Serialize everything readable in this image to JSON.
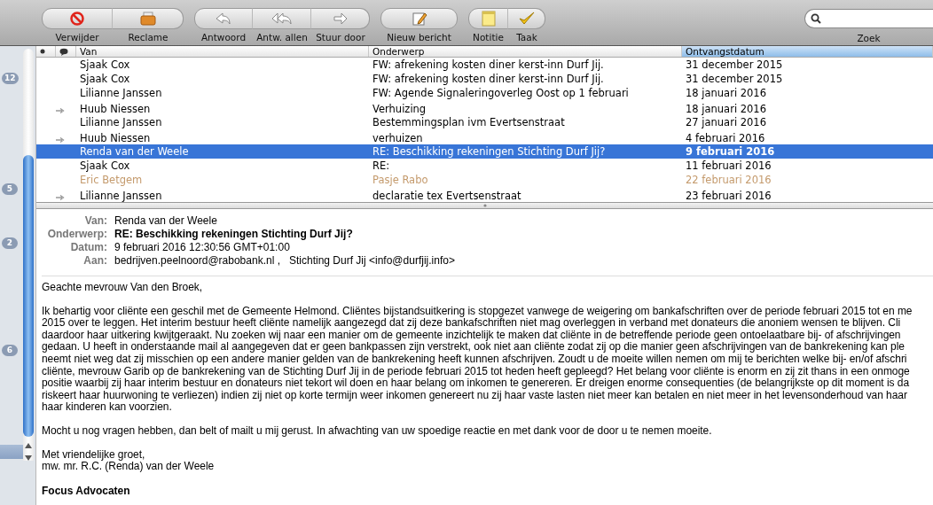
{
  "toolbar": {
    "groups": [
      {
        "buttons": [
          {
            "label": "Verwijder"
          },
          {
            "label": "Reclame"
          }
        ]
      },
      {
        "buttons": [
          {
            "label": "Antwoord"
          },
          {
            "label": "Antw. allen"
          },
          {
            "label": "Stuur door"
          }
        ]
      },
      {
        "buttons": [
          {
            "label": "Nieuw bericht"
          }
        ]
      },
      {
        "buttons": [
          {
            "label": "Notitie"
          },
          {
            "label": "Taak"
          }
        ]
      }
    ],
    "search": {
      "label": "Zoek"
    }
  },
  "sidebar": {
    "badges": [
      "12",
      "5",
      "2",
      "6"
    ]
  },
  "message_list": {
    "columns": [
      {
        "kind": "unread"
      },
      {
        "kind": "flag"
      },
      {
        "kind": "from",
        "label": "Van",
        "selected": false
      },
      {
        "kind": "subject",
        "label": "Onderwerp",
        "selected": false
      },
      {
        "kind": "date",
        "label": "Ontvangstdatum",
        "selected": true
      }
    ],
    "rows": [
      {
        "from": "Sjaak Cox",
        "subject": "FW: afrekening kosten diner kerst-inn Durf Jij.",
        "date": "31 december 2015",
        "forwarded": false,
        "selected": false
      },
      {
        "from": "Sjaak Cox",
        "subject": "FW: afrekening kosten diner kerst-inn Durf Jij.",
        "date": "31 december 2015",
        "forwarded": false,
        "selected": false
      },
      {
        "from": "Lilianne Janssen",
        "subject": "FW: Agende Signaleringoverleg Oost op 1 februari",
        "date": "18 januari 2016",
        "forwarded": false,
        "selected": false
      },
      {
        "from": "Huub Niessen",
        "subject": "Verhuizing",
        "date": "18 januari 2016",
        "forwarded": true,
        "selected": false
      },
      {
        "from": "Lilianne Janssen",
        "subject": "Bestemmingsplan ivm Evertsenstraat",
        "date": "27 januari 2016",
        "forwarded": false,
        "selected": false
      },
      {
        "from": "Huub Niessen",
        "subject": "verhuizen",
        "date": "4 februari 2016",
        "forwarded": true,
        "selected": false
      },
      {
        "from": "Renda van der Weele",
        "subject": "RE: Beschikking rekeningen Stichting Durf Jij?",
        "date": "9 februari 2016",
        "forwarded": false,
        "selected": true
      },
      {
        "from": "Sjaak Cox",
        "subject": "RE:",
        "date": "11 februari 2016",
        "forwarded": false,
        "selected": false
      },
      {
        "from": "Eric Betgem",
        "subject": "Pasje Rabo",
        "date": "22 februari 2016",
        "forwarded": false,
        "selected": false,
        "color": "#c49a6c"
      },
      {
        "from": "Lilianne Janssen",
        "subject": "declaratie tex Evertsenstraat",
        "date": "23 februari 2016",
        "forwarded": true,
        "selected": false
      }
    ]
  },
  "message": {
    "headers": [
      {
        "kind": "from",
        "label": "Van:",
        "value": "Renda van der Weele"
      },
      {
        "kind": "subject",
        "label": "Onderwerp:",
        "value": "RE: Beschikking rekeningen Stichting Durf Jij?"
      },
      {
        "kind": "date",
        "label": "Datum:",
        "value": "9 februari 2016 12:30:56 GMT+01:00"
      },
      {
        "kind": "to",
        "label": "Aan:",
        "value": "bedrijven.peelnoord@rabobank.nl ,   Stichting Durf Jij <info@durfjij.info>"
      }
    ],
    "body": [
      {
        "lines": [
          "Geachte mevrouw Van den Broek,"
        ]
      },
      {
        "lines": [
          "Ik behartig voor cliënte een geschil met de Gemeente Helmond. Cliëntes bijstandsuitkering is stopgezet vanwege de weigering om bankafschriften over de periode februari 2015 tot en me",
          "2015 over te leggen. Het interim bestuur heeft cliënte namelijk aangezegd dat zij deze bankafschriften niet mag overleggen in verband met donateurs die anoniem wensen te blijven. Cli",
          "daardoor haar uitkering kwijtgeraakt. Nu zoeken wij naar een manier om de gemeente inzichtelijk te maken dat cliënte in de betreffende periode geen ontoelaatbare bij- of afschrijvingen",
          "gedaan. U heeft in onderstaande mail al aangegeven dat er geen bankpassen zijn verstrekt, ook niet aan cliënte zodat zij op die manier geen afschrijvingen van de bankrekening kan ple",
          "neemt niet weg dat zij misschien op een andere manier gelden van de bankrekening heeft kunnen afschrijven. Zoudt u de moeite willen nemen om mij te berichten welke bij- en/of afschri",
          "cliënte, mevrouw Garib op de bankrekening van de Stichting Durf Jij in de periode februari 2015 tot heden heeft gepleegd? Het belang voor cliënte is enorm en zij zit thans in een onmoge",
          "positie waarbij zij haar interim bestuur en donateurs niet tekort wil doen en haar belang om inkomen te genereren. Er dreigen enorme consequenties (de belangrijkste op dit moment is da",
          "riskeert haar huurwoning te verliezen) indien zij niet op korte termijn weer inkomen genereert nu zij haar vaste lasten niet meer kan betalen en niet meer in het levensonderhoud van haar",
          "haar kinderen kan voorzien."
        ]
      },
      {
        "lines": [
          "Mocht u nog vragen hebben, dan belt of mailt u mij gerust. In afwachting van uw spoedige reactie en met dank voor de door u te nemen moeite."
        ]
      },
      {
        "lines": [
          "Met vriendelijke groet,",
          "mw. mr. R.C. (Renda) van der Weele"
        ]
      }
    ],
    "signature": "Focus Advocaten"
  }
}
